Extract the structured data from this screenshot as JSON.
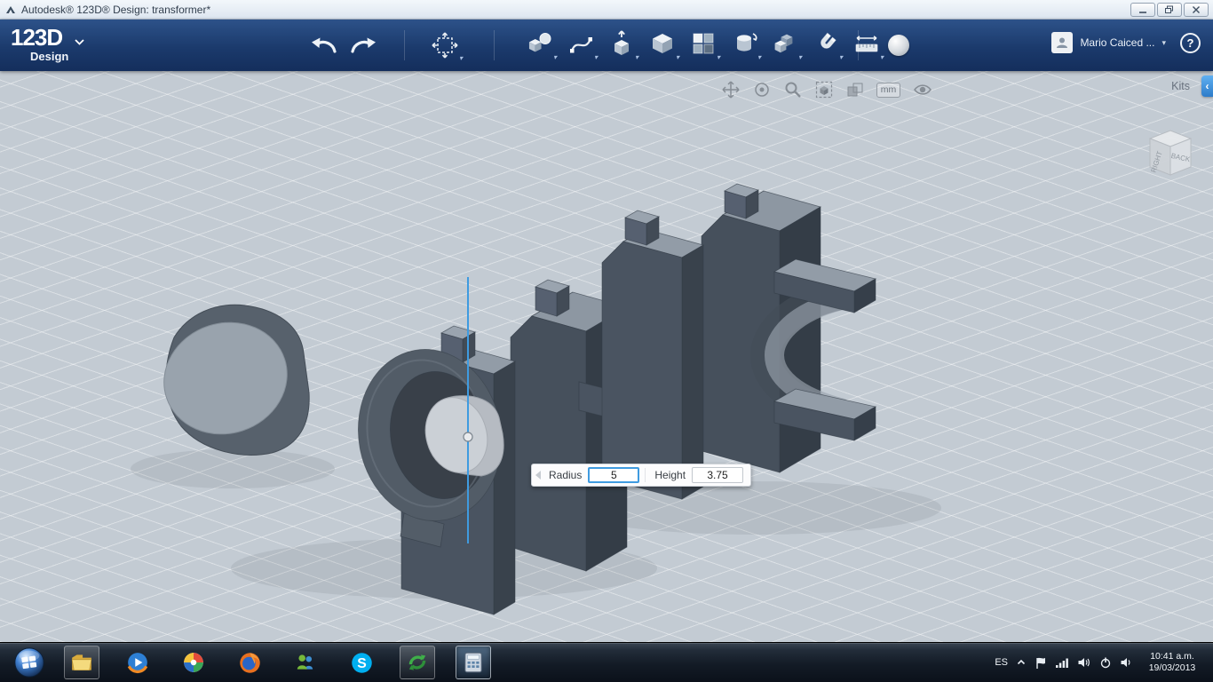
{
  "window": {
    "title": "Autodesk® 123D® Design: transformer*",
    "controls": [
      "minimize-button",
      "restore-button",
      "close-button"
    ]
  },
  "appbar": {
    "logo_text": "123D",
    "logo_sub": "Design",
    "history_icons": [
      "undo-icon",
      "redo-icon"
    ],
    "transform_tool_icon": "transform-move-icon",
    "tool_icons": [
      "primitives-icon",
      "sketch-icon",
      "extrude-icon",
      "solid-icon",
      "pattern-icon",
      "revolve-icon",
      "combine-icon",
      "magnet-snap-icon",
      "measure-icon"
    ],
    "material_tool_icon": "material-sphere-icon",
    "user_name": "Mario Caiced ...",
    "help_label": "?"
  },
  "viewport": {
    "nav_icons": [
      "pan-icon",
      "orbit-icon",
      "zoom-icon",
      "fit-view-icon",
      "display-mode-icon"
    ],
    "units_badge": "mm",
    "visibility_icon": "eye-icon",
    "kits_label": "Kits",
    "panel_toggle_icon": "collapse-chevron-icon",
    "viewcube": {
      "side_label": "RIGHT",
      "back_label": "BACK"
    }
  },
  "dialog": {
    "radius_label": "Radius",
    "radius_value": "5",
    "height_label": "Height",
    "height_value": "3.75"
  },
  "scene": {
    "objects": [
      "gray-cylinder",
      "transformer-core-left-half",
      "transformer-core-right-half",
      "new-cylinder-preview"
    ],
    "sketch_line_color": "#3f9be0"
  },
  "taskbar": {
    "start": "start-orb",
    "app_icons": [
      "explorer-icon",
      "media-player-icon",
      "pinwheel-icon",
      "firefox-icon",
      "messenger-icon",
      "skype-icon",
      "green-app-icon",
      "calculator-icon"
    ],
    "tray": {
      "language": "ES",
      "icons": [
        "hidden-icons-chevron",
        "action-center-flag-icon",
        "network-icon",
        "volume-icon",
        "power-icon",
        "volume2-icon"
      ],
      "time": "10:41 a.m.",
      "date": "19/03/2013"
    }
  },
  "colors": {
    "appbar_navy": "#1b3a6c",
    "accent_blue": "#2f86d6",
    "viewport_bg": "#c3cbd3",
    "object_dark": "#4a5461",
    "object_light": "#98a2ac"
  }
}
